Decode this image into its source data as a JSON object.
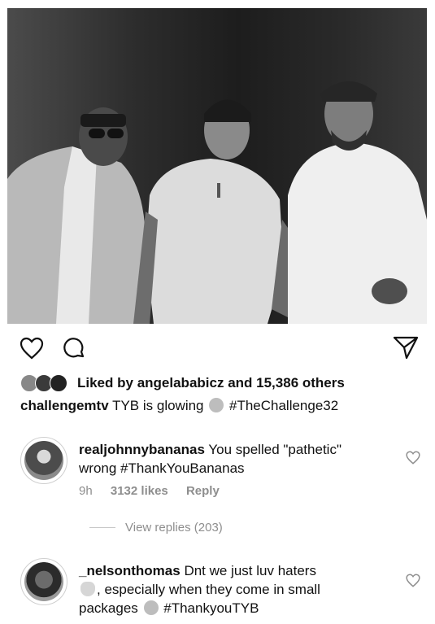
{
  "post": {
    "likes": {
      "prefix": "Liked by",
      "user": "angelababicz",
      "rest": "and 15,386 others"
    },
    "caption": {
      "user": "challengemtv",
      "text_before": "TYB is glowing",
      "hashtag": "#TheChallenge32"
    }
  },
  "comments": [
    {
      "user": "realjohnnybananas",
      "line1": "You spelled \"pathetic\"",
      "line2": "wrong #ThankYouBananas",
      "time": "9h",
      "likes": "3132 likes",
      "reply": "Reply"
    },
    {
      "user": "_nelsonthomas",
      "line1": "Dnt we just luv haters",
      "line2": ", especially when they come in small",
      "line3_before": "packages",
      "line3_hashtag": "#ThankyouTYB"
    }
  ],
  "view_replies": "View replies (203)",
  "icons": [
    "heart-icon",
    "comment-icon",
    "share-icon",
    "small-heart-icon"
  ]
}
